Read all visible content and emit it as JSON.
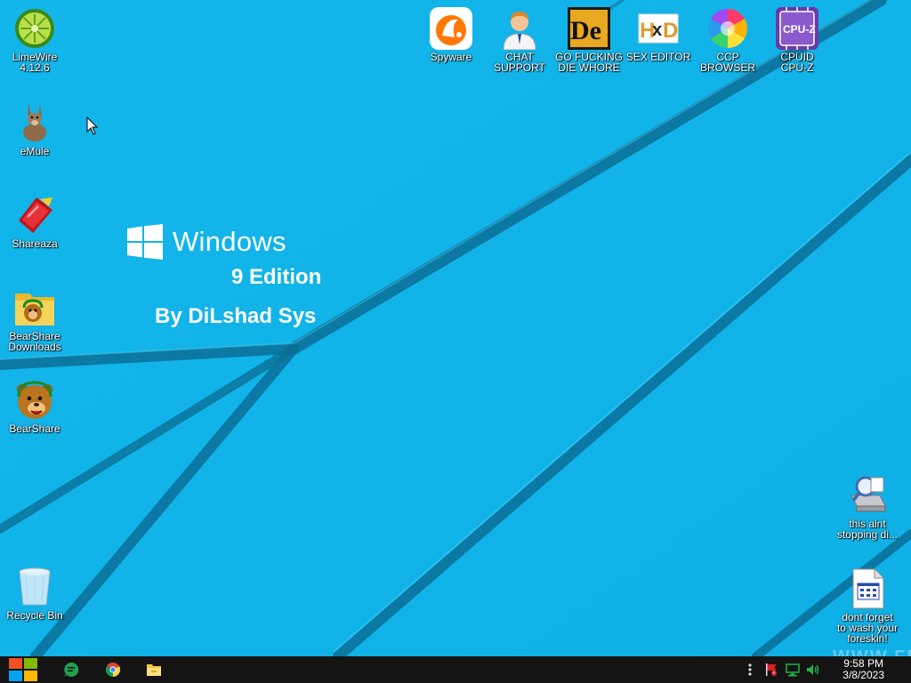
{
  "desktop": {
    "brand": {
      "title": "Windows",
      "edition": "9 Edition",
      "author": "By DiLshad Sys"
    },
    "watermark": "WWW.FR",
    "icons": [
      {
        "id": "limewire",
        "label": "LimeWire\n4.12.6",
        "icon": "limewire-icon"
      },
      {
        "id": "emule",
        "label": "eMule",
        "icon": "emule-donkey-icon"
      },
      {
        "id": "shareaza",
        "label": "Shareaza",
        "icon": "shareaza-icon"
      },
      {
        "id": "bearshare-downloads",
        "label": "BearShare\nDownloads",
        "icon": "bearshare-folder-icon"
      },
      {
        "id": "bearshare",
        "label": "BearShare",
        "icon": "bearshare-bear-icon"
      },
      {
        "id": "recycle-bin",
        "label": "Recycle Bin",
        "icon": "recycle-bin-icon"
      },
      {
        "id": "spyware",
        "label": "Spyware",
        "icon": "avast-icon"
      },
      {
        "id": "chat-support",
        "label": "CHAT\nSUPPORT",
        "icon": "support-agent-icon"
      },
      {
        "id": "die",
        "label": "GO FUCKING\nDIE WHORE",
        "icon": "die-icon"
      },
      {
        "id": "sex-editor",
        "label": "SEX EDITOR",
        "icon": "hxd-icon"
      },
      {
        "id": "ccp-browser",
        "label": "CCP\nBROWSER",
        "icon": "chromium-icon"
      },
      {
        "id": "cpuz",
        "label": "CPUID\nCPU-Z",
        "icon": "cpuz-icon"
      },
      {
        "id": "this-aint",
        "label": "this aint\nstopping di...",
        "icon": "disk-cleanup-icon"
      },
      {
        "id": "foreskin",
        "label": "dont forget\nto wash your\nforeskin!",
        "icon": "document-icon"
      }
    ]
  },
  "taskbar": {
    "time": "9:58 PM",
    "date": "3/8/2023",
    "colors": {
      "background": "#141414",
      "accent": "#22a050"
    }
  }
}
